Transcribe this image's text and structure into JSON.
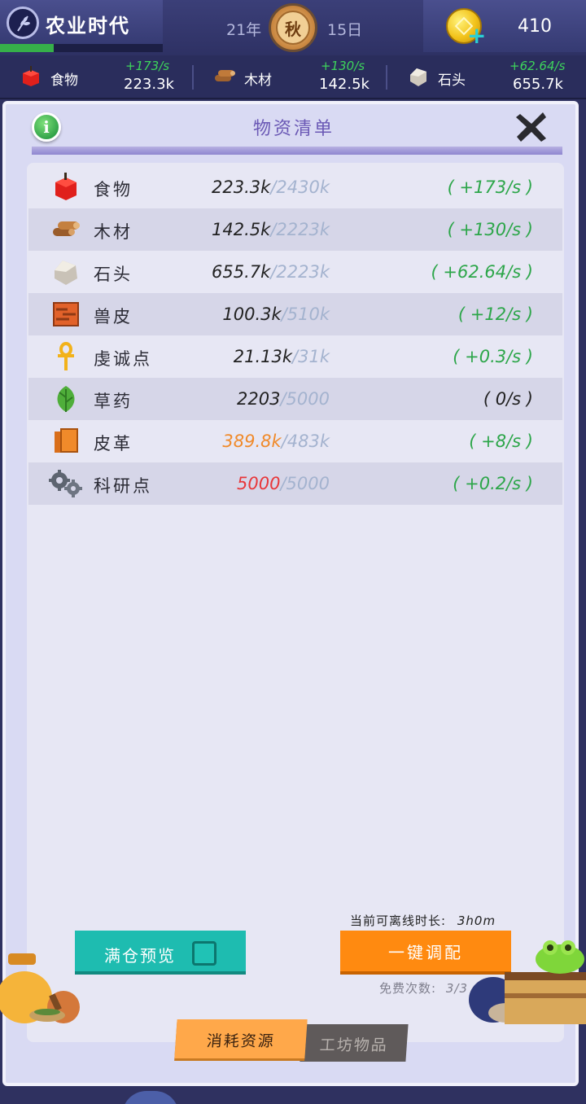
{
  "topbar": {
    "era_title": "农业时代",
    "era_progress": 0.33,
    "year": "21年",
    "season": "秋",
    "day": "15日",
    "coins": "410"
  },
  "resource_strip": [
    {
      "icon": "food-icon",
      "label": "食物",
      "rate": "+173/s",
      "value": "223.3k"
    },
    {
      "icon": "wood-icon",
      "label": "木材",
      "rate": "+130/s",
      "value": "142.5k"
    },
    {
      "icon": "stone-icon",
      "label": "石头",
      "rate": "+62.64/s",
      "value": "655.7k"
    }
  ],
  "panel": {
    "title": "物资清单",
    "info_label": "i"
  },
  "resources": [
    {
      "name": "食物",
      "current": "223.3k",
      "cap": "/2430k",
      "rate": "( +173/s )",
      "cur_style": "",
      "rate_style": ""
    },
    {
      "name": "木材",
      "current": "142.5k",
      "cap": "/2223k",
      "rate": "( +130/s )",
      "cur_style": "",
      "rate_style": ""
    },
    {
      "name": "石头",
      "current": "655.7k",
      "cap": "/2223k",
      "rate": "( +62.64/s )",
      "cur_style": "",
      "rate_style": ""
    },
    {
      "name": "兽皮",
      "current": "100.3k",
      "cap": "/510k",
      "rate": "( +12/s )",
      "cur_style": "",
      "rate_style": ""
    },
    {
      "name": "虔诚点",
      "current": "21.13k",
      "cap": "/31k",
      "rate": "( +0.3/s )",
      "cur_style": "",
      "rate_style": ""
    },
    {
      "name": "草药",
      "current": "2203",
      "cap": "/5000",
      "rate": "( 0/s )",
      "cur_style": "",
      "rate_style": "black"
    },
    {
      "name": "皮革",
      "current": "389.8k",
      "cap": "/483k",
      "rate": "( +8/s )",
      "cur_style": "orange",
      "rate_style": ""
    },
    {
      "name": "科研点",
      "current": "5000",
      "cap": "/5000",
      "rate": "( +0.2/s )",
      "cur_style": "red",
      "rate_style": ""
    }
  ],
  "bottom": {
    "offline_label": "当前可离线时长:",
    "offline_value": "3h0m",
    "preview_label": "满仓预览",
    "preview_checked": false,
    "dispatch_label": "一键调配",
    "free_label": "免费次数:",
    "free_value": "3/3"
  },
  "tabs": {
    "active": "消耗资源",
    "inactive": "工坊物品"
  },
  "colors": {
    "rate_green": "#2da64a",
    "warn_orange": "#f08a2a",
    "full_red": "#e8373a",
    "cap_gray": "#a4b3cf",
    "title_purple": "#6a58b5",
    "preview_teal": "#1ebcb0",
    "dispatch_orange": "#ff8a10"
  }
}
